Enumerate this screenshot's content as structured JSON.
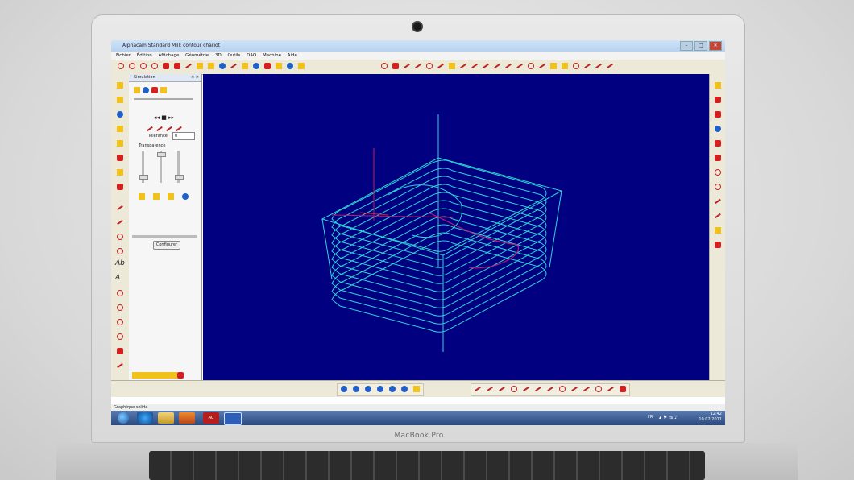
{
  "window": {
    "title": "Alphacam Standard Mill: contour chariot",
    "buttons": [
      "–",
      "□",
      "✕"
    ]
  },
  "menu": [
    "Fichier",
    "Édition",
    "Affichage",
    "Géométrie",
    "3D",
    "Outils",
    "DAO",
    "Machine",
    "Aide"
  ],
  "panel": {
    "title": "Simulation",
    "close": "× ✕",
    "tolerance_label": "Tolérance",
    "tolerance_value": "0",
    "transparence_label": "Transparence",
    "configure_button": "Configurer"
  },
  "status": {
    "text": "Graphique solide"
  },
  "taskbar": {
    "lang": "FR",
    "time": "12:42",
    "date": "10.02.2011",
    "app_label": "AC"
  },
  "laptop": {
    "brand": "MacBook Pro"
  },
  "colors": {
    "viewport_bg": "#000080",
    "wire_cyan": "#2fd3d8",
    "wire_magenta": "#c2187a",
    "wire_red": "#d02040"
  }
}
